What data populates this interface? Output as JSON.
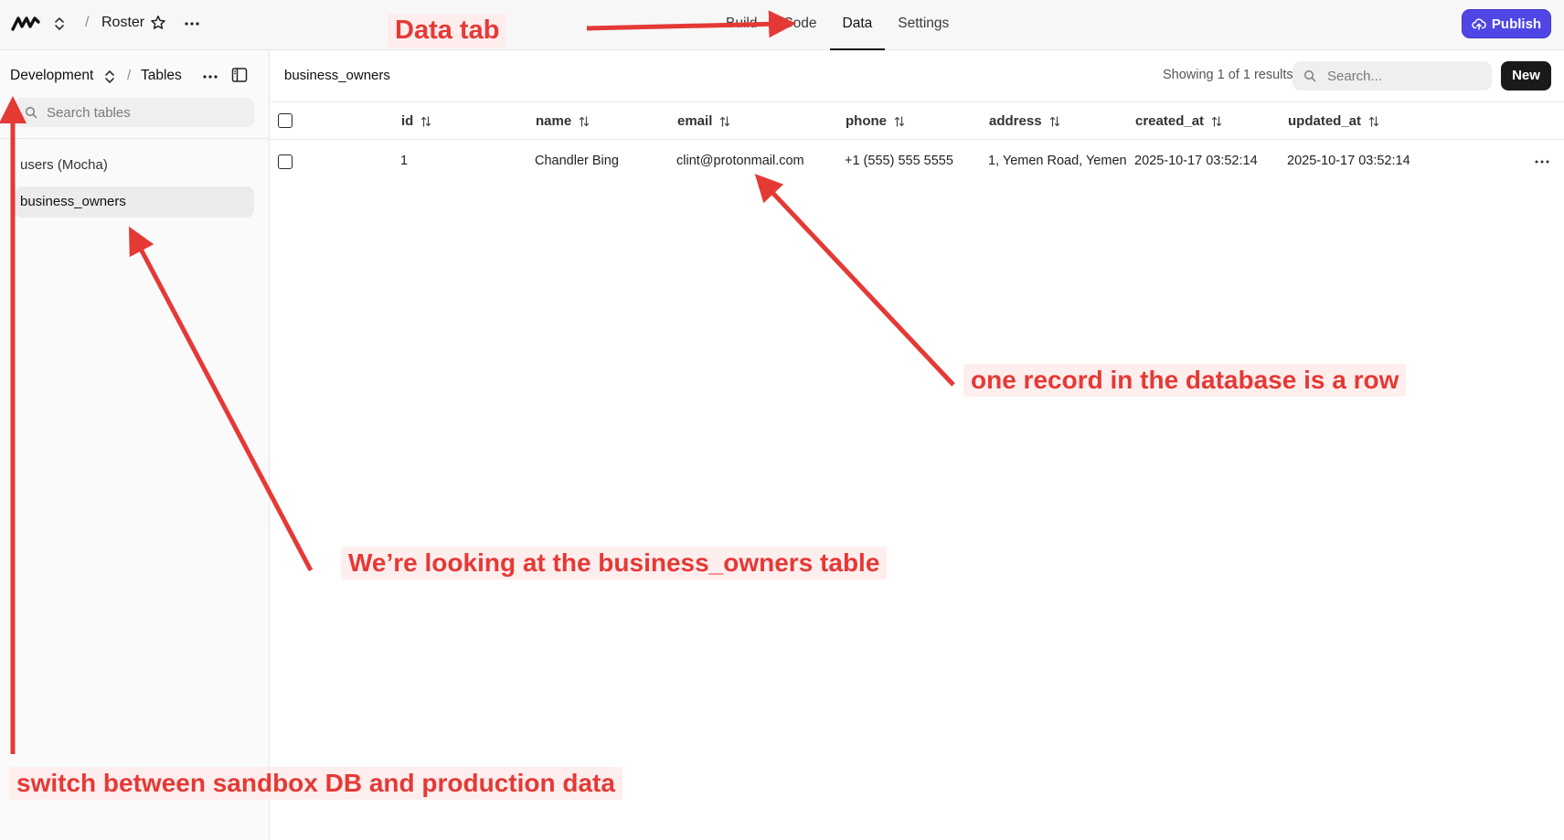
{
  "topbar": {
    "project_name": "Roster",
    "separator": "/",
    "tabs": [
      {
        "label": "Build"
      },
      {
        "label": "Code"
      },
      {
        "label": "Data"
      },
      {
        "label": "Settings"
      }
    ],
    "publish_label": "Publish"
  },
  "sidebar": {
    "environment": "Development",
    "separator": "/",
    "section": "Tables",
    "search_placeholder": "Search tables",
    "tables": [
      {
        "label": "users (Mocha)"
      },
      {
        "label": "business_owners"
      }
    ]
  },
  "main": {
    "table_name": "business_owners",
    "results_text": "Showing 1 of 1 results",
    "search_placeholder": "Search...",
    "new_label": "New",
    "columns": [
      "id",
      "name",
      "email",
      "phone",
      "address",
      "created_at",
      "updated_at"
    ],
    "rows": [
      {
        "id": "1",
        "name": "Chandler Bing",
        "email": "clint@protonmail.com",
        "phone": "+1 (555) 555 5555",
        "address": "1, Yemen Road, Yemen",
        "created_at": "2025-10-17 03:52:14",
        "updated_at": "2025-10-17 03:52:14"
      }
    ]
  },
  "annotations": {
    "data_tab": "Data tab",
    "row": "one record in the database is a row",
    "table": "We’re looking at the business_owners table",
    "env": "switch between sandbox DB and production data"
  },
  "colors": {
    "accent": "#4f46e5",
    "annotation": "#e53935",
    "selected_bg": "#ececec"
  }
}
